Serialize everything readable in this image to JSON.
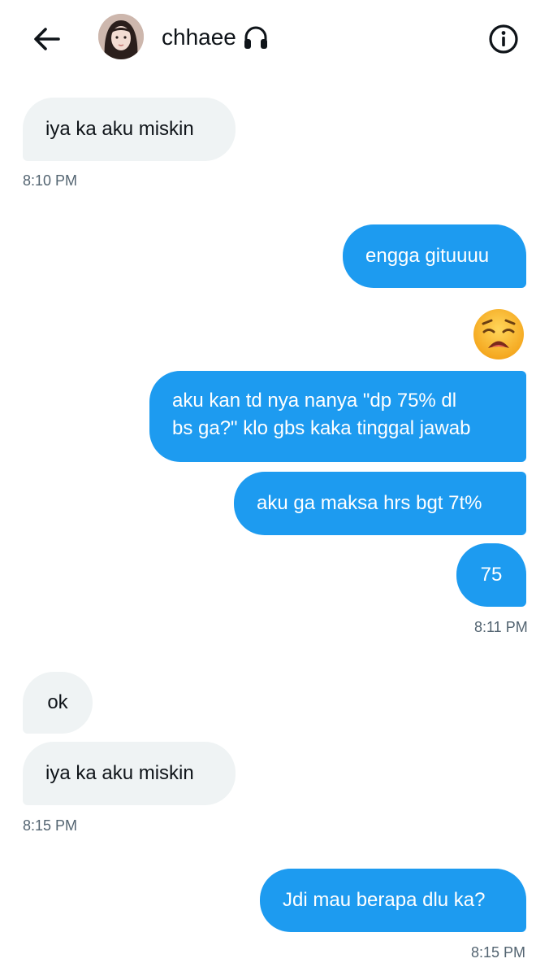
{
  "header": {
    "contact_name": "chhaee",
    "name_icon": "headphones-icon",
    "back_icon": "arrow-left-icon",
    "info_icon": "info-icon"
  },
  "messages": {
    "m1": {
      "text": "iya ka aku miskin",
      "time": "8:10 PM"
    },
    "m2": {
      "text": "engga gituuuu"
    },
    "m3": {
      "emoji": "weary-face-emoji"
    },
    "m4": {
      "line1": "aku kan td nya nanya \"dp 75% dl",
      "line2": "bs ga?\" klo gbs kaka tinggal jawab"
    },
    "m5": {
      "text": "aku ga maksa hrs bgt 7t%"
    },
    "m6": {
      "text": "75",
      "time": "8:11 PM"
    },
    "m7": {
      "text": "ok"
    },
    "m8": {
      "text": "iya ka aku miskin",
      "time": "8:15 PM"
    },
    "m9": {
      "text": "Jdi mau berapa dlu ka?",
      "time": "8:15 PM"
    }
  },
  "colors": {
    "outgoing": "#1d9bf0",
    "incoming": "#eff3f4",
    "timestamp": "#536471"
  }
}
